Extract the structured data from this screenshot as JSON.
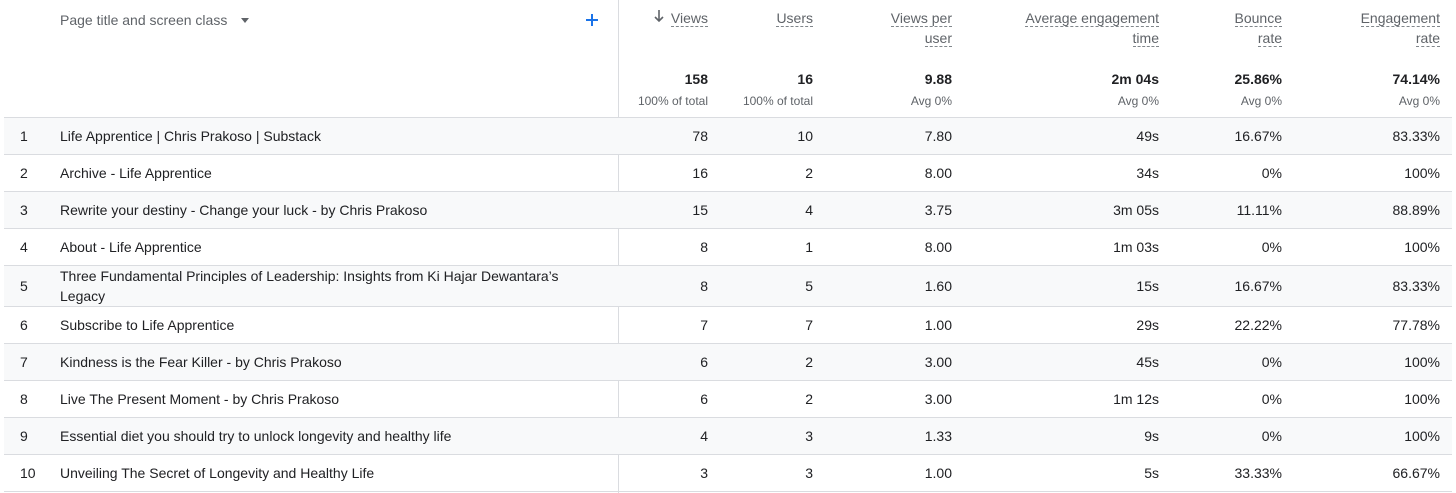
{
  "dimension": {
    "label": "Page title and screen class"
  },
  "colors": {
    "accent": "#1a73e8",
    "border": "#dadce0",
    "row_alt": "#f8f9fa"
  },
  "icons": {
    "add": "plus-icon",
    "sort": "arrow-down-icon",
    "dropdown": "caret-down-icon"
  },
  "columns": [
    {
      "key": "views",
      "label_lines": [
        "Views"
      ],
      "total": "158",
      "sub": "100% of total",
      "sorted": true
    },
    {
      "key": "users",
      "label_lines": [
        "Users"
      ],
      "total": "16",
      "sub": "100% of total"
    },
    {
      "key": "views_per_user",
      "label_lines": [
        "Views per",
        "user"
      ],
      "total": "9.88",
      "sub": "Avg 0%"
    },
    {
      "key": "avg_engagement",
      "label_lines": [
        "Average engagement",
        "time"
      ],
      "total": "2m 04s",
      "sub": "Avg 0%"
    },
    {
      "key": "bounce_rate",
      "label_lines": [
        "Bounce",
        "rate"
      ],
      "total": "25.86%",
      "sub": "Avg 0%"
    },
    {
      "key": "engagement_rate",
      "label_lines": [
        "Engagement",
        "rate"
      ],
      "total": "74.14%",
      "sub": "Avg 0%"
    }
  ],
  "rows": [
    {
      "idx": "1",
      "title": "Life Apprentice | Chris Prakoso | Substack",
      "views": "78",
      "users": "10",
      "vpu": "7.80",
      "aet": "49s",
      "bounce": "16.67%",
      "eng": "83.33%"
    },
    {
      "idx": "2",
      "title": "Archive - Life Apprentice",
      "views": "16",
      "users": "2",
      "vpu": "8.00",
      "aet": "34s",
      "bounce": "0%",
      "eng": "100%"
    },
    {
      "idx": "3",
      "title": "Rewrite your destiny - Change your luck - by Chris Prakoso",
      "views": "15",
      "users": "4",
      "vpu": "3.75",
      "aet": "3m 05s",
      "bounce": "11.11%",
      "eng": "88.89%"
    },
    {
      "idx": "4",
      "title": "About - Life Apprentice",
      "views": "8",
      "users": "1",
      "vpu": "8.00",
      "aet": "1m 03s",
      "bounce": "0%",
      "eng": "100%"
    },
    {
      "idx": "5",
      "title": "Three Fundamental Principles of Leadership: Insights from Ki Hajar Dewantara’s Legacy",
      "views": "8",
      "users": "5",
      "vpu": "1.60",
      "aet": "15s",
      "bounce": "16.67%",
      "eng": "83.33%"
    },
    {
      "idx": "6",
      "title": "Subscribe to Life Apprentice",
      "views": "7",
      "users": "7",
      "vpu": "1.00",
      "aet": "29s",
      "bounce": "22.22%",
      "eng": "77.78%"
    },
    {
      "idx": "7",
      "title": "Kindness is the Fear Killer - by Chris Prakoso",
      "views": "6",
      "users": "2",
      "vpu": "3.00",
      "aet": "45s",
      "bounce": "0%",
      "eng": "100%"
    },
    {
      "idx": "8",
      "title": "Live The Present Moment - by Chris Prakoso",
      "views": "6",
      "users": "2",
      "vpu": "3.00",
      "aet": "1m 12s",
      "bounce": "0%",
      "eng": "100%"
    },
    {
      "idx": "9",
      "title": "Essential diet you should try to unlock longevity and healthy life",
      "views": "4",
      "users": "3",
      "vpu": "1.33",
      "aet": "9s",
      "bounce": "0%",
      "eng": "100%"
    },
    {
      "idx": "10",
      "title": "Unveiling The Secret of Longevity and Healthy Life",
      "views": "3",
      "users": "3",
      "vpu": "1.00",
      "aet": "5s",
      "bounce": "33.33%",
      "eng": "66.67%"
    }
  ]
}
